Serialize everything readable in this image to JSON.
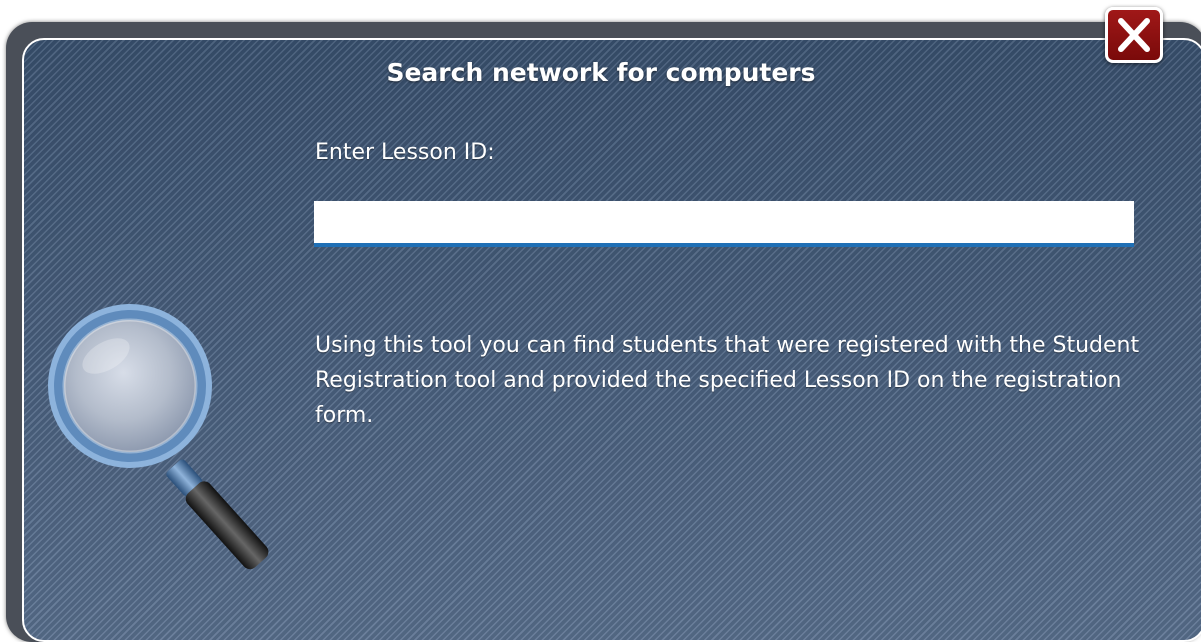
{
  "dialog": {
    "title": "Search network for computers",
    "lesson_id_label": "Enter Lesson ID:",
    "lesson_id_value": "",
    "description": "Using this tool you can find students that were registered with the Student Registration tool and provided the specified Lesson ID on the registration form."
  },
  "icons": {
    "close": "close-icon",
    "search": "magnifying-glass-icon"
  },
  "colors": {
    "panel_background": "#425874",
    "close_button": "#8e1010",
    "input_underline": "#1f6fb5"
  }
}
